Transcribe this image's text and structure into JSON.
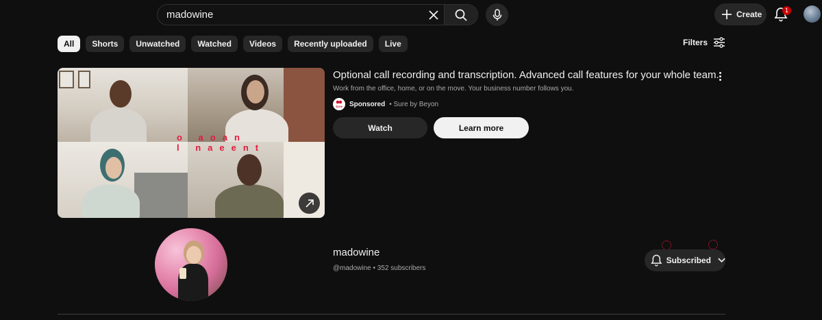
{
  "search": {
    "query": "madowine"
  },
  "header": {
    "create_label": "Create",
    "notification_count": "1"
  },
  "chips": [
    "All",
    "Shorts",
    "Unwatched",
    "Watched",
    "Videos",
    "Recently uploaded",
    "Live"
  ],
  "filters_label": "Filters",
  "ad": {
    "title": "Optional call recording and transcription. Advanced call features for your whole team.",
    "description": "Work from the office, home, or on the move. Your business number follows you.",
    "sponsored": "Sponsored",
    "advertiser": "Sure by Beyon",
    "logo_text": "Sure",
    "watch_label": "Watch",
    "learn_more_label": "Learn more",
    "overlay_line1": "o aoan",
    "overlay_line2": "l naeent"
  },
  "channel": {
    "name": "madowine",
    "handle_subs": "@madowine • 352 subscribers",
    "subscribed_label": "Subscribed"
  },
  "colors": {
    "background": "#0f0f0f",
    "chip": "#272727",
    "accent_red": "#cc0000"
  }
}
